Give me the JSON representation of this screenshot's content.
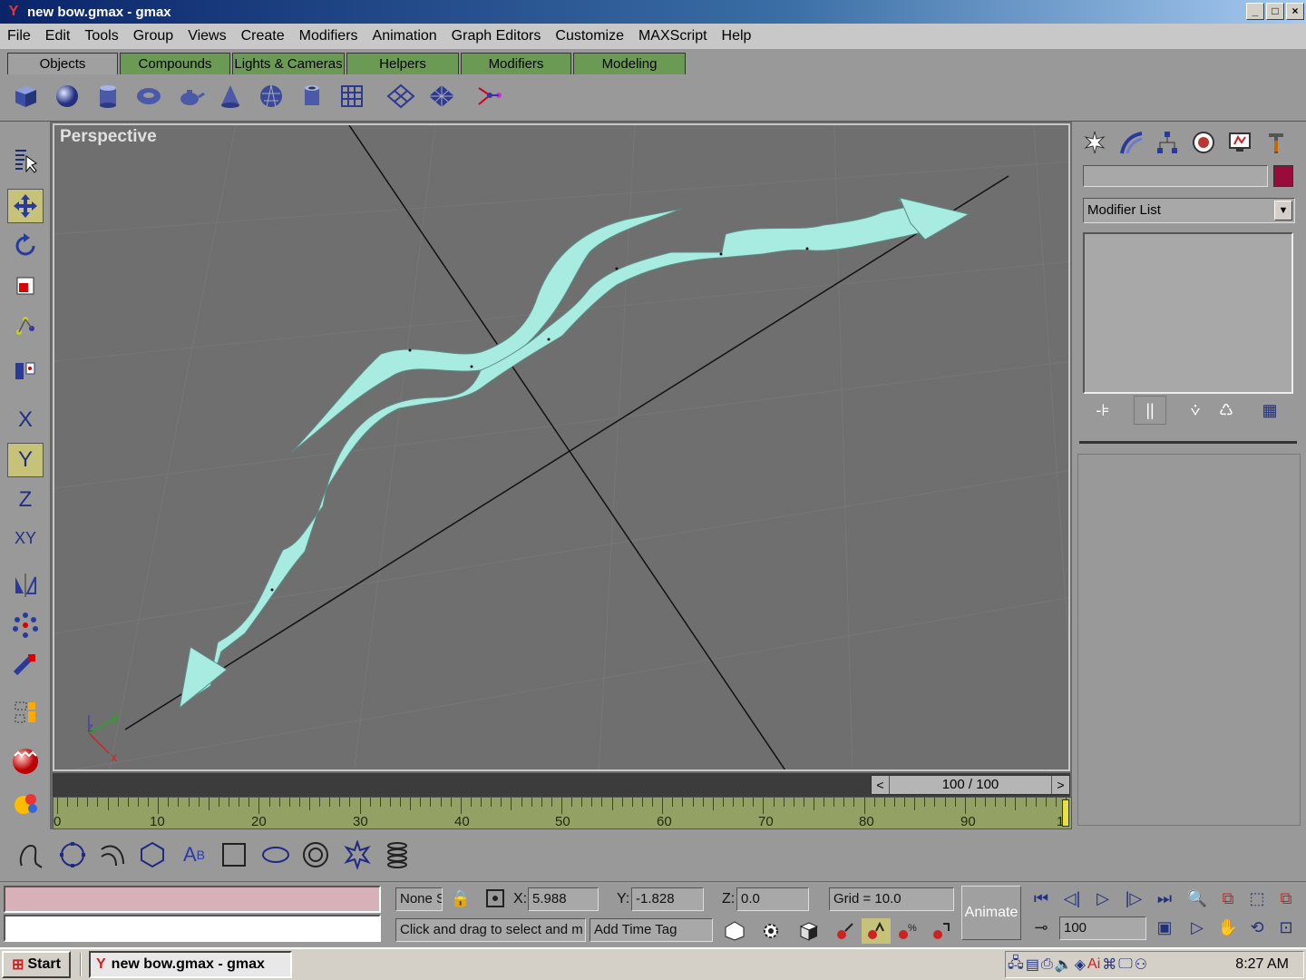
{
  "window": {
    "title": "new bow.gmax - gmax",
    "buttons": [
      "_",
      "□",
      "×"
    ]
  },
  "menu": [
    "File",
    "Edit",
    "Tools",
    "Group",
    "Views",
    "Create",
    "Modifiers",
    "Animation",
    "Graph Editors",
    "Customize",
    "MAXScript",
    "Help"
  ],
  "tabs": [
    "Objects",
    "Compounds",
    "Lights & Cameras",
    "Helpers",
    "Modifiers",
    "Modeling"
  ],
  "tab_active": "Objects",
  "object_toolbar_icons": [
    "box-icon",
    "sphere-icon",
    "cylinder-icon",
    "torus-icon",
    "teapot-icon",
    "cone-icon",
    "geosphere-icon",
    "tube-icon",
    "grid-icon",
    "plane-icon",
    "plane-alt-icon",
    "bones-icon"
  ],
  "left_toolbar_icons": [
    "select-icon",
    "move-icon",
    "rotate-icon",
    "scale-icon",
    "hierarchy-icon",
    "align-icon",
    "axis-x-icon",
    "axis-y-icon",
    "axis-z-icon",
    "axis-xy-icon",
    "mirror-icon",
    "array-icon",
    "snap-icon",
    "named-selection-icon",
    "material-editor-icon",
    "render-icon"
  ],
  "left_toolbar_labels": {
    "x": "X",
    "y": "Y",
    "z": "Z",
    "xy": "XY"
  },
  "viewport": {
    "label": "Perspective",
    "mesh_color": "#a8ebe0",
    "background": "#6f6f6f"
  },
  "right_panel": {
    "tab_icons": [
      "create-icon",
      "modify-icon",
      "hierarchy-icon",
      "motion-icon",
      "display-icon",
      "utilities-icon"
    ],
    "object_color": "#9a0a3a",
    "modifier_list": "Modifier List",
    "stack_buttons": [
      "pin-stack-icon",
      "show-end-result-icon",
      "make-unique-icon",
      "remove-modifier-icon",
      "configure-icon"
    ]
  },
  "time_slider": {
    "value": "100 / 100",
    "prev": "<",
    "next": ">"
  },
  "trackbar": {
    "labels": [
      "0",
      "10",
      "20",
      "30",
      "40",
      "50",
      "60",
      "70",
      "80",
      "90",
      "1"
    ]
  },
  "shapes_toolbar_icons": [
    "line-icon",
    "circle-icon",
    "arc-icon",
    "ngon-icon",
    "text-icon",
    "rectangle-icon",
    "ellipse-icon",
    "donut-icon",
    "star-icon",
    "helix-icon"
  ],
  "status": {
    "selection": "None S",
    "x_label": "X:",
    "x_value": "5.988",
    "y_label": "Y:",
    "y_value": "-1.828",
    "z_label": "Z:",
    "z_value": "0.0",
    "grid": "Grid = 10.0",
    "prompt": "Click and drag to select and m",
    "add_time_tag": "Add Time Tag",
    "animate": "Animate",
    "frame": "100"
  },
  "taskbar": {
    "start": "Start",
    "task": "new bow.gmax - gmax",
    "clock": "8:27 AM"
  }
}
